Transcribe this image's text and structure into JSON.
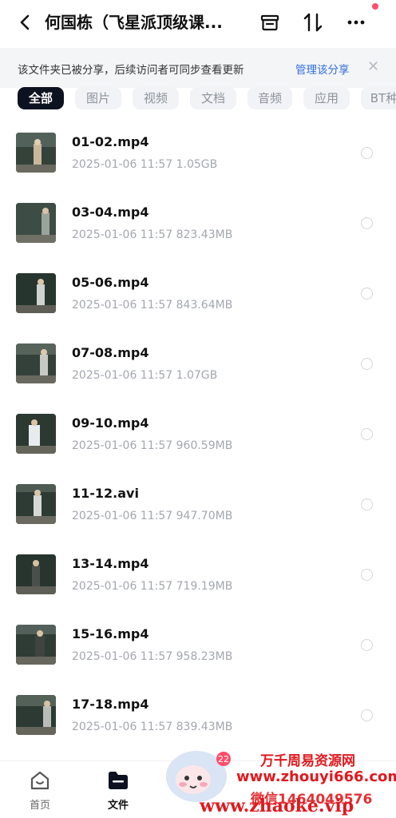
{
  "header": {
    "title": "何国栋（飞星派顶级课...",
    "icons": [
      "back-icon",
      "archive-icon",
      "sort-icon",
      "more-icon"
    ]
  },
  "banner": {
    "text": "该文件夹已被分享，后续访问者可同步查看更新",
    "link": "管理该分享"
  },
  "filters": [
    "全部",
    "图片",
    "视频",
    "文档",
    "音频",
    "应用",
    "BT种"
  ],
  "active_filter": "全部",
  "files": [
    {
      "name": "01-02.mp4",
      "date": "2025-01-06  11:57",
      "size": "1.05GB"
    },
    {
      "name": "03-04.mp4",
      "date": "2025-01-06  11:57",
      "size": "823.43MB"
    },
    {
      "name": "05-06.mp4",
      "date": "2025-01-06  11:57",
      "size": "843.64MB"
    },
    {
      "name": "07-08.mp4",
      "date": "2025-01-06  11:57",
      "size": "1.07GB"
    },
    {
      "name": "09-10.mp4",
      "date": "2025-01-06  11:57",
      "size": "960.59MB"
    },
    {
      "name": "11-12.avi",
      "date": "2025-01-06  11:57",
      "size": "947.70MB"
    },
    {
      "name": "13-14.mp4",
      "date": "2025-01-06  11:57",
      "size": "719.19MB"
    },
    {
      "name": "15-16.mp4",
      "date": "2025-01-06  11:57",
      "size": "958.23MB"
    },
    {
      "name": "17-18.mp4",
      "date": "2025-01-06  11:57",
      "size": "839.43MB"
    }
  ],
  "nav": {
    "home": "首页",
    "files": "文件"
  },
  "watermark": {
    "line1": "万千周易资源网",
    "line2": "www.zhouyi666.com",
    "line3": "微信1464049576",
    "line4": "www.zhaoke.vip",
    "badge": "22"
  }
}
